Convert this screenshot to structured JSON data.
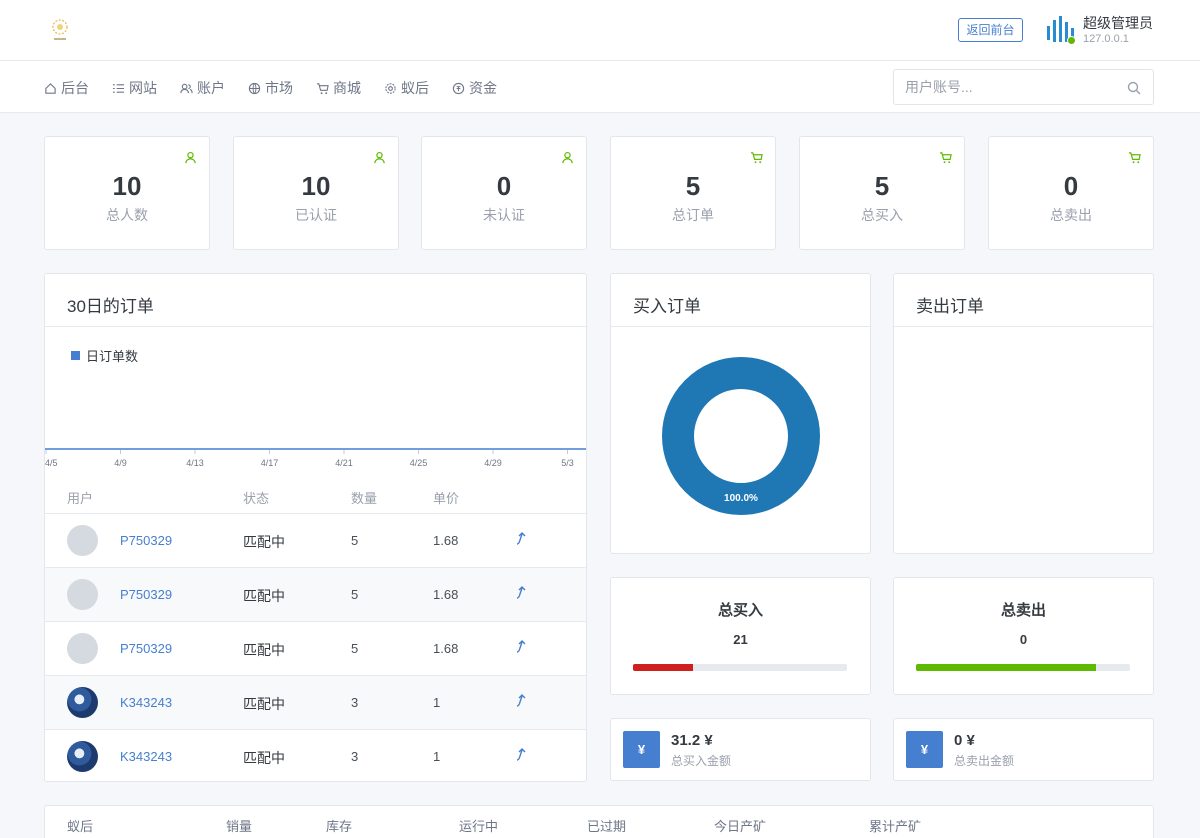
{
  "header": {
    "back_button": "返回前台",
    "user_name": "超级管理员",
    "user_ip": "127.0.0.1"
  },
  "nav": {
    "items": [
      {
        "label": "后台",
        "icon": "home-icon"
      },
      {
        "label": "网站",
        "icon": "list-icon"
      },
      {
        "label": "账户",
        "icon": "users-icon"
      },
      {
        "label": "市场",
        "icon": "globe-icon"
      },
      {
        "label": "商城",
        "icon": "cart-icon"
      },
      {
        "label": "蚁后",
        "icon": "gear-icon"
      },
      {
        "label": "资金",
        "icon": "coin-icon"
      }
    ],
    "search_placeholder": "用户账号..."
  },
  "stats": [
    {
      "value": "10",
      "label": "总人数",
      "icon": "user-icon"
    },
    {
      "value": "10",
      "label": "已认证",
      "icon": "user-icon"
    },
    {
      "value": "0",
      "label": "未认证",
      "icon": "user-icon"
    },
    {
      "value": "5",
      "label": "总订单",
      "icon": "cart-icon"
    },
    {
      "value": "5",
      "label": "总买入",
      "icon": "cart-icon"
    },
    {
      "value": "0",
      "label": "总卖出",
      "icon": "cart-icon"
    }
  ],
  "orders_card": {
    "title": "30日的订单",
    "legend": "日订单数",
    "columns": [
      "用户",
      "状态",
      "数量",
      "单价"
    ],
    "rows": [
      {
        "user": "P750329",
        "status": "匹配中",
        "qty": "5",
        "price": "1.68",
        "avatar": "gray"
      },
      {
        "user": "P750329",
        "status": "匹配中",
        "qty": "5",
        "price": "1.68",
        "avatar": "gray"
      },
      {
        "user": "P750329",
        "status": "匹配中",
        "qty": "5",
        "price": "1.68",
        "avatar": "gray"
      },
      {
        "user": "K343243",
        "status": "匹配中",
        "qty": "3",
        "price": "1",
        "avatar": "photo"
      },
      {
        "user": "K343243",
        "status": "匹配中",
        "qty": "3",
        "price": "1",
        "avatar": "photo"
      }
    ]
  },
  "chart_data": [
    {
      "type": "line",
      "legend": [
        "日订单数"
      ],
      "x_ticks": [
        "4/5",
        "4/9",
        "4/13",
        "4/17",
        "4/21",
        "4/25",
        "4/29",
        "5/3"
      ],
      "series": [
        {
          "name": "日订单数",
          "values": [
            0,
            0,
            0,
            0,
            0,
            0,
            0,
            0
          ]
        }
      ],
      "color": "#467fcf"
    },
    {
      "type": "pie",
      "title": "买入订单",
      "slices": [
        {
          "value": 100.0,
          "label": "100.0%"
        }
      ],
      "color": "#1f77b4",
      "donut": true
    }
  ],
  "buy_card": {
    "title": "买入订单"
  },
  "sell_card": {
    "title": "卖出订单"
  },
  "totals": {
    "buy": {
      "title": "总买入",
      "value": "21",
      "fill_fraction": 0.28,
      "color": "#cd201f"
    },
    "sell": {
      "title": "总卖出",
      "value": "0",
      "fill_fraction": 0.84,
      "color": "#5eba00"
    }
  },
  "money": {
    "buy": {
      "symbol": "¥",
      "value": "31.2 ¥",
      "label": "总买入金额"
    },
    "sell": {
      "symbol": "¥",
      "value": "0 ¥",
      "label": "总卖出金额"
    }
  },
  "bottom_table": {
    "columns": [
      "蚁后",
      "销量",
      "库存",
      "运行中",
      "已过期",
      "今日产矿",
      "累计产矿"
    ]
  }
}
